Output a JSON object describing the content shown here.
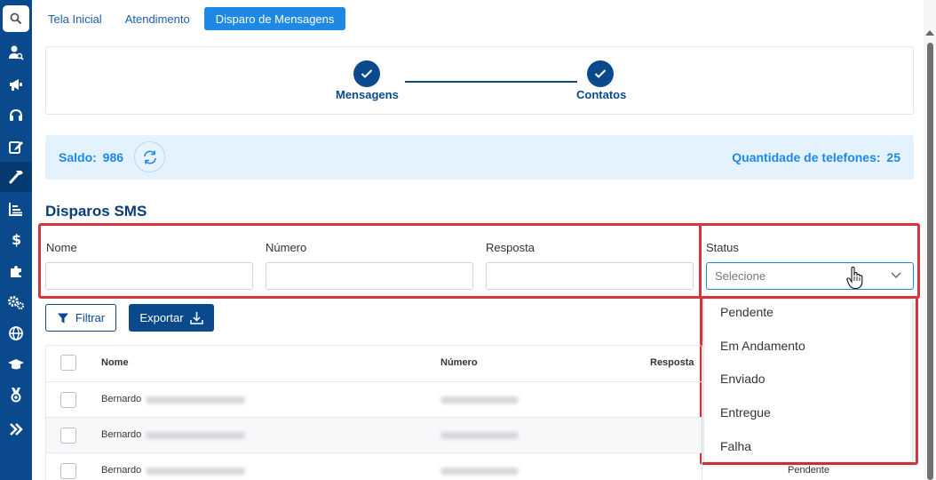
{
  "tabs": [
    {
      "label": "Tela Inicial"
    },
    {
      "label": "Atendimento"
    },
    {
      "label": "Disparo de Mensagens"
    }
  ],
  "sidebar": {
    "items": [
      {
        "icon": "search-icon"
      },
      {
        "icon": "user-search-icon"
      },
      {
        "icon": "megaphone-icon"
      },
      {
        "icon": "headset-icon"
      },
      {
        "icon": "edit-icon"
      },
      {
        "icon": "hammer-icon"
      },
      {
        "icon": "chart-icon"
      },
      {
        "icon": "dollar-icon"
      },
      {
        "icon": "puzzle-icon"
      },
      {
        "icon": "gears-icon"
      },
      {
        "icon": "globe-icon"
      },
      {
        "icon": "graduation-cap-icon"
      },
      {
        "icon": "medal-icon"
      },
      {
        "icon": "double-chevron-right-icon"
      }
    ]
  },
  "stepper": {
    "steps": [
      {
        "label": "Mensagens",
        "done": true
      },
      {
        "label": "Contatos",
        "done": true
      }
    ]
  },
  "balance": {
    "saldo_label": "Saldo:",
    "saldo_value": "986",
    "qtd_label": "Quantidade de telefones:",
    "qtd_value": "25"
  },
  "section_title": "Disparos SMS",
  "filters": {
    "nome_label": "Nome",
    "numero_label": "Número",
    "resposta_label": "Resposta",
    "status_label": "Status",
    "status_placeholder": "Selecione"
  },
  "buttons": {
    "filter_label": "Filtrar",
    "export_label": "Exportar"
  },
  "table": {
    "headers": {
      "nome": "Nome",
      "numero": "Número",
      "resposta": "Resposta"
    },
    "rows": [
      {
        "nome": "Bernardo",
        "status": ""
      },
      {
        "nome": "Bernardo",
        "status": ""
      },
      {
        "nome": "Bernardo",
        "status": "Pendente"
      }
    ]
  },
  "status_dropdown": {
    "options": [
      "Pendente",
      "Em Andamento",
      "Enviado",
      "Entregue",
      "Falha"
    ]
  },
  "colors": {
    "sidebar": "#0a4a8c",
    "accent": "#1e88e5",
    "highlight": "#d9343c"
  }
}
